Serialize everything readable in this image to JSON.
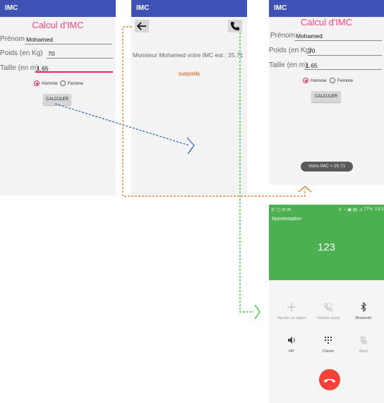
{
  "app_title": "IMC",
  "form": {
    "heading": "Calcul d'IMC",
    "prenom_label": "Prénom",
    "prenom_value": "Mohamed",
    "poids_label": "Poids (en Kg)",
    "poids_value": "70",
    "taille_label": "Taille (en m)",
    "taille_value": "1.65",
    "radio_homme": "Homme",
    "radio_femme": "Femme",
    "selected_gender": "Homme",
    "calc_button": "CALCULER"
  },
  "result_screen": {
    "message": "Monsieur Mohamed votre IMC est : 25.71",
    "category": "surpoids",
    "back_icon": "arrow-left-icon",
    "call_icon": "phone-icon"
  },
  "toast": {
    "text": "Votre IMC = 25.71"
  },
  "dialer": {
    "status_battery": "77%",
    "status_time": "15:3",
    "header_label": "Numérotation",
    "number": "123",
    "actions": [
      {
        "label": "Ajouter un appel",
        "icon": "plus-icon"
      },
      {
        "label": "Volume suppl",
        "icon": "volume-phone-icon"
      },
      {
        "label": "Bluetooth",
        "icon": "bluetooth-icon"
      },
      {
        "label": "HP",
        "icon": "speaker-icon"
      },
      {
        "label": "Clavier",
        "icon": "keypad-icon"
      },
      {
        "label": "Muet",
        "icon": "mute-icon"
      }
    ],
    "end_call_icon": "end-call-icon"
  },
  "colors": {
    "appbar": "#3f51b5",
    "accent": "#ff4081",
    "result_category": "#e65100",
    "dialer_green": "#4caf50",
    "end_call": "#f44336",
    "arrow_blue": "#1e5fb4",
    "arrow_orange": "#f07010",
    "arrow_green": "#22c322"
  }
}
